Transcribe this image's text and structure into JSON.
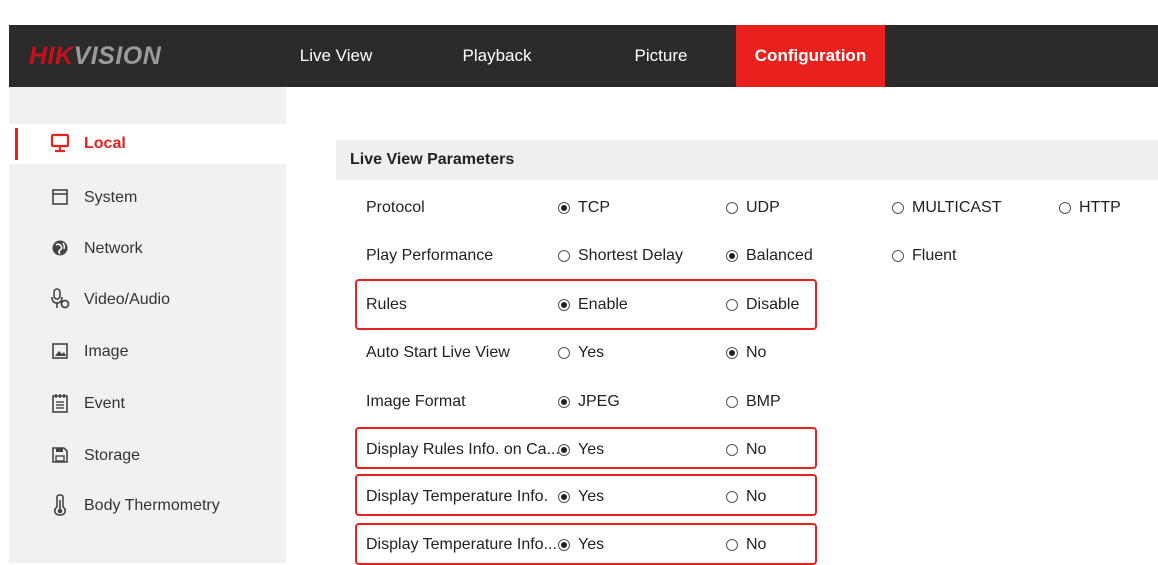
{
  "brand": {
    "logo_part1": "HIK",
    "logo_part2": "VISION"
  },
  "nav": {
    "items": [
      "Live View",
      "Playback",
      "Picture",
      "Configuration"
    ],
    "active": "Configuration"
  },
  "sidebar": {
    "items": [
      {
        "label": "Local",
        "icon": "monitor-icon"
      },
      {
        "label": "System",
        "icon": "window-icon"
      },
      {
        "label": "Network",
        "icon": "globe-icon"
      },
      {
        "label": "Video/Audio",
        "icon": "microphone-icon"
      },
      {
        "label": "Image",
        "icon": "image-icon"
      },
      {
        "label": "Event",
        "icon": "calendar-icon"
      },
      {
        "label": "Storage",
        "icon": "save-icon"
      },
      {
        "label": "Body Thermometry",
        "icon": "thermometer-icon"
      }
    ],
    "active": "Local"
  },
  "section": {
    "title": "Live View Parameters"
  },
  "params": [
    {
      "label": "Protocol",
      "options": [
        "TCP",
        "UDP",
        "MULTICAST",
        "HTTP"
      ],
      "selected": "TCP",
      "highlighted": false
    },
    {
      "label": "Play Performance",
      "options": [
        "Shortest Delay",
        "Balanced",
        "Fluent"
      ],
      "selected": "Balanced",
      "highlighted": false
    },
    {
      "label": "Rules",
      "options": [
        "Enable",
        "Disable"
      ],
      "selected": "Enable",
      "highlighted": true
    },
    {
      "label": "Auto Start Live View",
      "options": [
        "Yes",
        "No"
      ],
      "selected": "No",
      "highlighted": false
    },
    {
      "label": "Image Format",
      "options": [
        "JPEG",
        "BMP"
      ],
      "selected": "JPEG",
      "highlighted": false
    },
    {
      "label": "Display Rules Info. on Ca...",
      "options": [
        "Yes",
        "No"
      ],
      "selected": "Yes",
      "highlighted": true
    },
    {
      "label": "Display Temperature Info.",
      "options": [
        "Yes",
        "No"
      ],
      "selected": "Yes",
      "highlighted": true
    },
    {
      "label": "Display Temperature Info...",
      "options": [
        "Yes",
        "No"
      ],
      "selected": "Yes",
      "highlighted": true
    }
  ],
  "colors": {
    "accent": "#e8201e",
    "topbar": "#2b2b2b",
    "sidebar": "#f1f1f1",
    "highlight": "#e8201e"
  }
}
